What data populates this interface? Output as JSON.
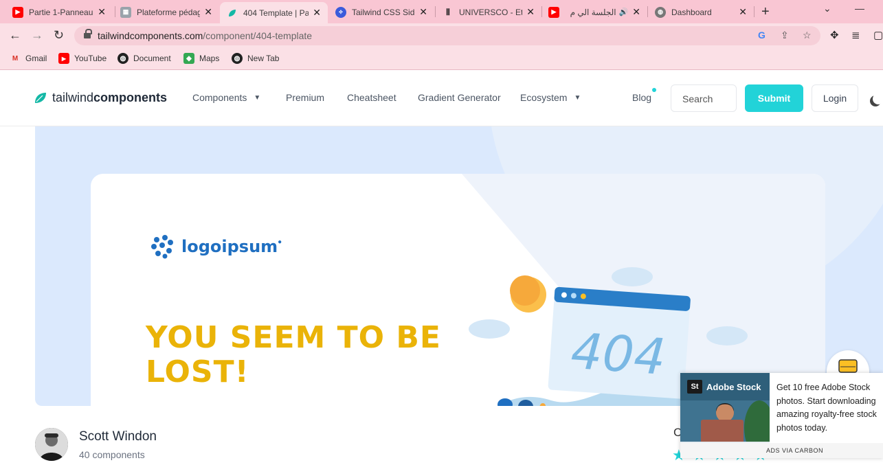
{
  "browser": {
    "tabs": [
      {
        "title": "Partie 1-Panneau",
        "icon": "youtube-icon",
        "active": false
      },
      {
        "title": "Plateforme pédag",
        "icon": "platform-icon",
        "active": false
      },
      {
        "title": "404 Template | Pa",
        "icon": "tailwind-leaf-icon",
        "active": true
      },
      {
        "title": "Tailwind CSS Side",
        "icon": "tailwind-side-icon",
        "active": false
      },
      {
        "title": "UNIVERSCO - Etu",
        "icon": "universco-icon",
        "active": false
      },
      {
        "title": "الجلسة الي م",
        "icon": "youtube-icon",
        "active": false
      },
      {
        "title": "Dashboard",
        "icon": "globe-icon",
        "active": false
      }
    ],
    "url_host": "tailwindcomponents.com",
    "url_path": "/component/404-template",
    "bookmarks": [
      {
        "label": "Gmail",
        "icon": "gmail-icon"
      },
      {
        "label": "YouTube",
        "icon": "youtube-icon"
      },
      {
        "label": "Document",
        "icon": "globe-icon"
      },
      {
        "label": "Maps",
        "icon": "maps-icon"
      },
      {
        "label": "New Tab",
        "icon": "globe-icon"
      }
    ]
  },
  "site": {
    "brand_light": "tailwind",
    "brand_bold": "components",
    "nav": {
      "components": "Components",
      "premium": "Premium",
      "cheatsheet": "Cheatsheet",
      "gradient": "Gradient Generator",
      "ecosystem": "Ecosystem",
      "blog": "Blog"
    },
    "search_placeholder": "Search",
    "submit_label": "Submit",
    "login_label": "Login",
    "accent": "#22d3d8"
  },
  "preview": {
    "logo_text": "logoipsum",
    "headline_line1": "YOU SEEM TO BE",
    "headline_line2": "LOST!",
    "illustration_text": "404",
    "headline_color": "#eab308"
  },
  "author": {
    "name": "Scott Windon",
    "count": "40 components"
  },
  "ad": {
    "brand": "Adobe Stock",
    "brand_badge": "St",
    "text": "Get 10 free Adobe Stock photos. Start downloading amazing royalty-free stock photos today.",
    "via": "ADS VIA CARBON"
  }
}
